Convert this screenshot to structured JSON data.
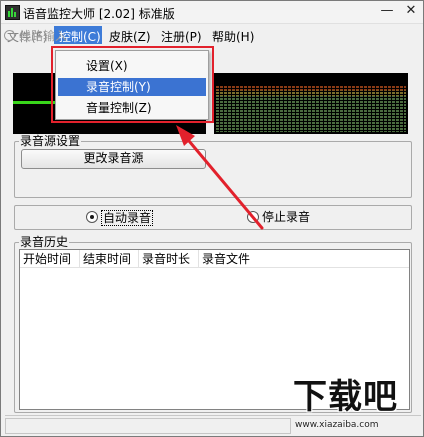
{
  "window": {
    "title": "语音监控大师 [2.02] 标准版"
  },
  "window_controls": {
    "minimize": "—",
    "close": "✕"
  },
  "menu": {
    "items": [
      "文件(F)",
      "控制(C)",
      "皮肤(Z)",
      "注册(P)",
      "帮助(H)"
    ],
    "radio_hint": "线路输入"
  },
  "dropdown": {
    "items": [
      {
        "label": "设置(X)",
        "selected": false
      },
      {
        "label": "录音控制(Y)",
        "selected": true
      },
      {
        "label": "音量控制(Z)",
        "selected": false
      }
    ]
  },
  "record_source": {
    "title": "录音源设置",
    "button": "更改录音源"
  },
  "record_mode": {
    "auto_label": "自动录音",
    "stop_label": "停止录音",
    "selected": "auto"
  },
  "history": {
    "title": "录音历史",
    "columns": [
      "开始时间",
      "结束时间",
      "录音时长",
      "录音文件"
    ],
    "rows": []
  },
  "watermark": {
    "logo": "下载吧",
    "url": "www.xiazaiba.com"
  },
  "colors": {
    "annotation": "#e2212c",
    "selection": "#3b73d2",
    "scope_line": "#39d61b"
  }
}
